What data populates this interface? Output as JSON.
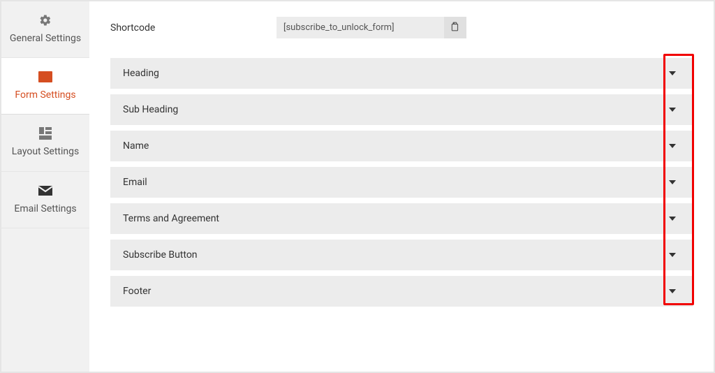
{
  "sidebar": {
    "tabs": [
      {
        "label": "General Settings"
      },
      {
        "label": "Form Settings"
      },
      {
        "label": "Layout Settings"
      },
      {
        "label": "Email Settings"
      }
    ]
  },
  "shortcode": {
    "label": "Shortcode",
    "value": "[subscribe_to_unlock_form]"
  },
  "accordion": {
    "items": [
      {
        "title": "Heading"
      },
      {
        "title": "Sub Heading"
      },
      {
        "title": "Name"
      },
      {
        "title": "Email"
      },
      {
        "title": "Terms and Agreement"
      },
      {
        "title": "Subscribe Button"
      },
      {
        "title": "Footer"
      }
    ]
  }
}
